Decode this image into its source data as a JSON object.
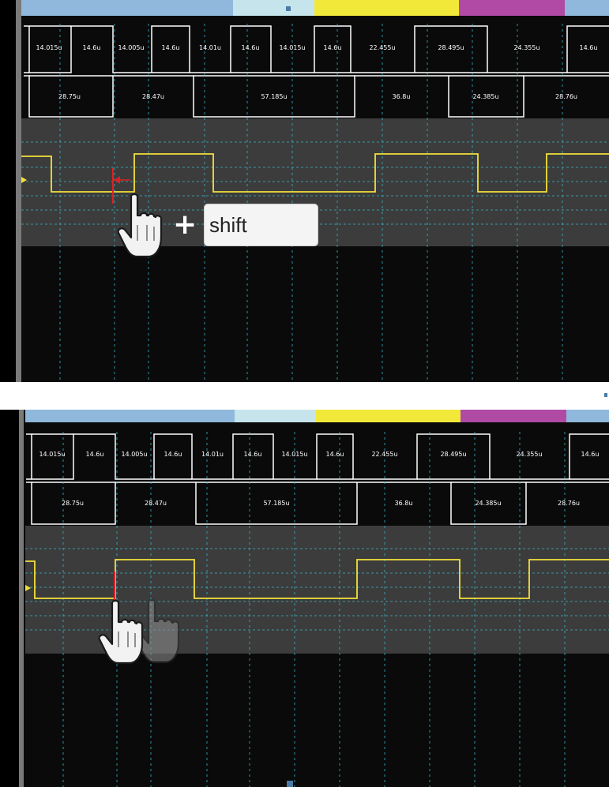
{
  "shortcut": {
    "modifier_key": "shift",
    "plus_symbol": "+"
  },
  "colors": {
    "bus_trace": "#ffffff",
    "signal_trace": "#f2e03a",
    "cursor_marker": "#e02020",
    "grid_dash": "#37b6c6",
    "overview_blue": "#8fb8dc",
    "overview_light_blue": "#c6e4ec",
    "overview_yellow": "#f2e83a",
    "overview_magenta": "#b04aa5"
  },
  "icons": [
    "hand-pointer-icon",
    "ghost-hand-pointer-icon",
    "trigger-arrow-icon",
    "cursor-marker-icon"
  ],
  "bus_rows": {
    "row1_labels": [
      "14.015u",
      "14.6u",
      "14.005u",
      "14.6u",
      "14.01u",
      "14.6u",
      "14.015u",
      "14.6u",
      "22.455u",
      "28.495u",
      "24.355u",
      "14.6u"
    ],
    "row2_labels": [
      "28.75u",
      "28.47u",
      "57.185u",
      "36.8u",
      "24.385u",
      "28.76u"
    ]
  }
}
